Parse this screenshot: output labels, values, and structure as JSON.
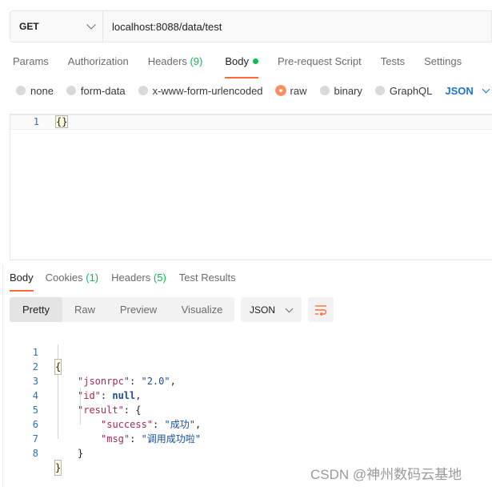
{
  "request": {
    "method": "GET",
    "url": "localhost:8088/data/test"
  },
  "request_tabs": [
    {
      "label": "Params",
      "count": ""
    },
    {
      "label": "Authorization",
      "count": ""
    },
    {
      "label": "Headers",
      "count": "(9)"
    },
    {
      "label": "Body",
      "count": ""
    },
    {
      "label": "Pre-request Script",
      "count": ""
    },
    {
      "label": "Tests",
      "count": ""
    },
    {
      "label": "Settings",
      "count": ""
    }
  ],
  "body_types": [
    "none",
    "form-data",
    "x-www-form-urlencoded",
    "raw",
    "binary",
    "GraphQL"
  ],
  "body_format": "JSON",
  "editor": {
    "line_number": "1",
    "content": "{}"
  },
  "response_tabs": [
    {
      "label": "Body",
      "count": ""
    },
    {
      "label": "Cookies",
      "count": "(1)"
    },
    {
      "label": "Headers",
      "count": "(5)"
    },
    {
      "label": "Test Results",
      "count": ""
    }
  ],
  "view_modes": [
    "Pretty",
    "Raw",
    "Preview",
    "Visualize"
  ],
  "response_format": "JSON",
  "response_lines": [
    {
      "n": "1"
    },
    {
      "n": "2"
    },
    {
      "n": "3"
    },
    {
      "n": "4"
    },
    {
      "n": "5"
    },
    {
      "n": "6"
    },
    {
      "n": "7"
    },
    {
      "n": "8"
    }
  ],
  "response": {
    "open_brace": "{",
    "jsonrpc_key": "\"jsonrpc\"",
    "jsonrpc_value": "\"2.0\"",
    "id_key": "\"id\"",
    "id_value": "null",
    "result_key": "\"result\"",
    "result_open": "{",
    "success_key": "\"success\"",
    "success_value": "\"成功\"",
    "msg_key": "\"msg\"",
    "msg_value": "\"调用成功啦\"",
    "result_close": "}",
    "close_brace": "}"
  },
  "watermark": "CSDN @神州数码云基地",
  "colors": {
    "accent": "#ff6c37",
    "green": "#0cbb52",
    "blue": "#1f72d6"
  }
}
